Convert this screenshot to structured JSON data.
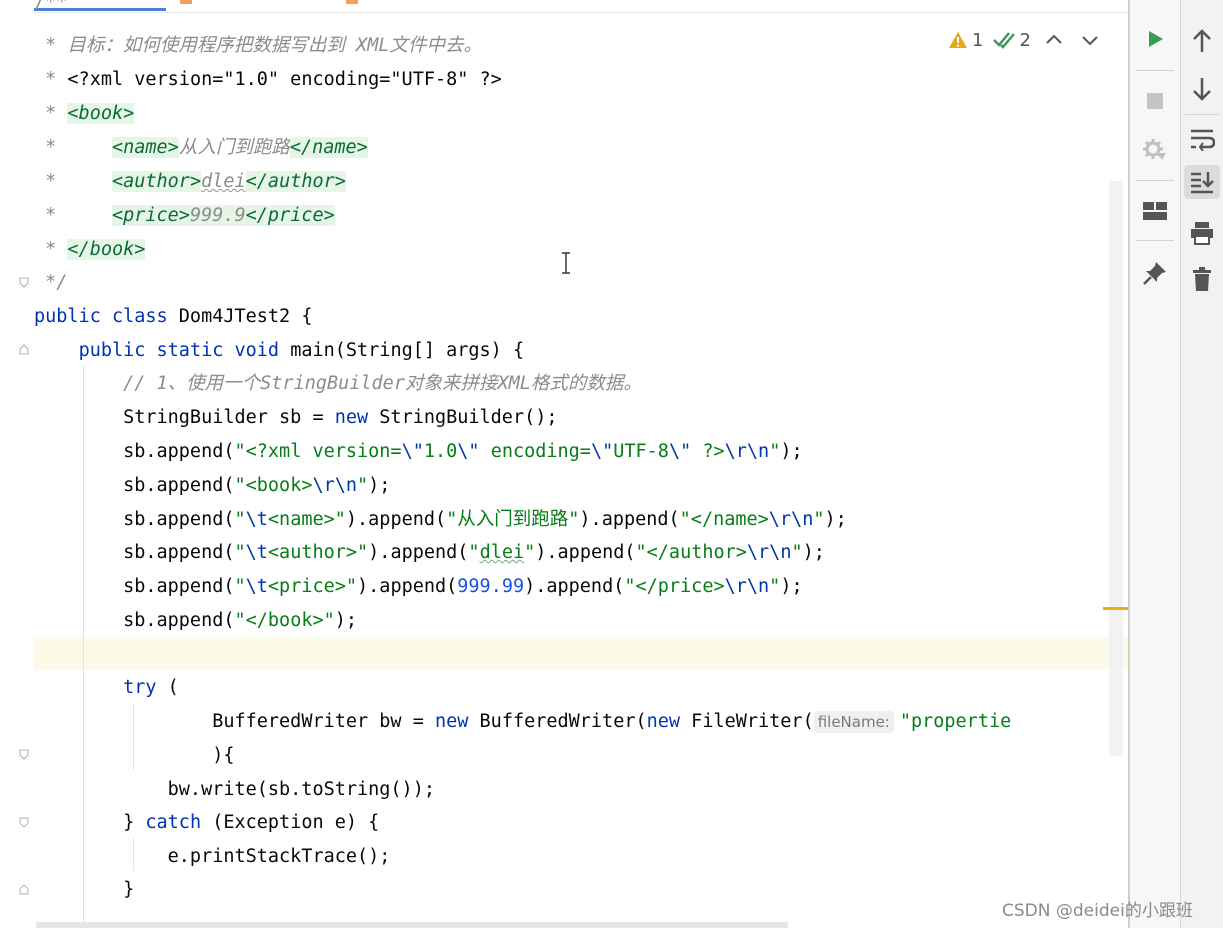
{
  "editor": {
    "comment_lines": [
      {
        "prefix": " * ",
        "text": "目标：如何使用程序把数据写出到 XML文件中去。"
      },
      {
        "prefix": " * ",
        "text": "<?xml version=\"1.0\" encoding=\"UTF-8\" ?>"
      }
    ],
    "xml_book_open": "<book>",
    "xml_name_open": "<name>",
    "xml_name_value": "从入门到跑路",
    "xml_name_close": "</name>",
    "xml_author_open": "<author>",
    "xml_author_value": "dlei",
    "xml_author_close": "</author>",
    "xml_price_open": "<price>",
    "xml_price_value": "999.9",
    "xml_price_close": "</price>",
    "xml_book_close": "</book>",
    "comment_star": "*",
    "comment_end": "*/",
    "class_decl": {
      "mods": "public class",
      "name": "Dom4JTest2",
      "brace": "{"
    },
    "main_decl": {
      "mods": "public static void",
      "name": "main",
      "params": "(String[] args) {"
    },
    "line_comment": "// 1、使用一个StringBuilder对象来拼接XML格式的数据。",
    "sb_decl": {
      "type": "StringBuilder sb = ",
      "kw": "new",
      "rest": " StringBuilder();"
    },
    "append_prefix": "sb.append(",
    "append_1": {
      "s1": "\"<?xml version=",
      "e1": "\\\"",
      "s2": "1.0",
      "e2": "\\\"",
      "s3": " encoding=",
      "e3": "\\\"",
      "s4": "UTF-8",
      "e4": "\\\"",
      "s5": " ?>",
      "e5": "\\r\\n",
      "s6": "\""
    },
    "append_2": {
      "s1": "\"<book>",
      "e1": "\\r\\n",
      "s2": "\""
    },
    "append_3": {
      "e0": "\\t",
      "q": "\"",
      "s1": "<name>\"",
      "mid1": ").append(",
      "s2": "\"从入门到跑路\"",
      "mid2": ").append(",
      "s3": "\"</name>",
      "e1": "\\r\\n",
      "s4": "\""
    },
    "append_4": {
      "e0": "\\t",
      "q": "\"",
      "s1": "<author>\"",
      "mid1": ").append(",
      "s2a": "\"",
      "s2b": "dlei",
      "s2c": "\"",
      "mid2": ").append(",
      "s3": "\"</author>",
      "e1": "\\r\\n",
      "s4": "\""
    },
    "append_5": {
      "e0": "\\t",
      "q": "\"",
      "s1": "<price>\"",
      "mid1": ").append(",
      "num": "999.99",
      "mid2": ").append(",
      "s3": "\"</price>",
      "e1": "\\r\\n",
      "s4": "\""
    },
    "append_6": {
      "s1": "\"</book>\""
    },
    "close_paren": ");",
    "try_kw": "try",
    "try_paren": " (",
    "bw_decl": {
      "type": "BufferedWriter bw = ",
      "kw1": "new",
      "mid": " BufferedWriter(",
      "kw2": "new",
      "rest": " FileWriter(",
      "hint": "fileName:",
      "str": "\"propertie"
    },
    "bw_close": "){",
    "bw_write": "bw.write(sb.toString());",
    "catch_open": "} ",
    "catch_kw": "catch",
    "catch_rest": " (Exception e) {",
    "print_trace": "e.printStackTrace();",
    "close_brace": "}"
  },
  "inspections": {
    "warnings": "1",
    "weak_warnings": "2"
  },
  "watermark": "CSDN @deidei的小跟班",
  "icons": {
    "run": "run-icon",
    "stop": "stop-icon",
    "debug": "debug-gear-icon",
    "layout": "layout-icon",
    "pin": "pin-icon",
    "up": "arrow-up-icon",
    "down": "arrow-down-icon",
    "wrap": "soft-wrap-icon",
    "scroll": "scroll-to-end-icon",
    "print": "print-icon",
    "trash": "trash-icon"
  }
}
